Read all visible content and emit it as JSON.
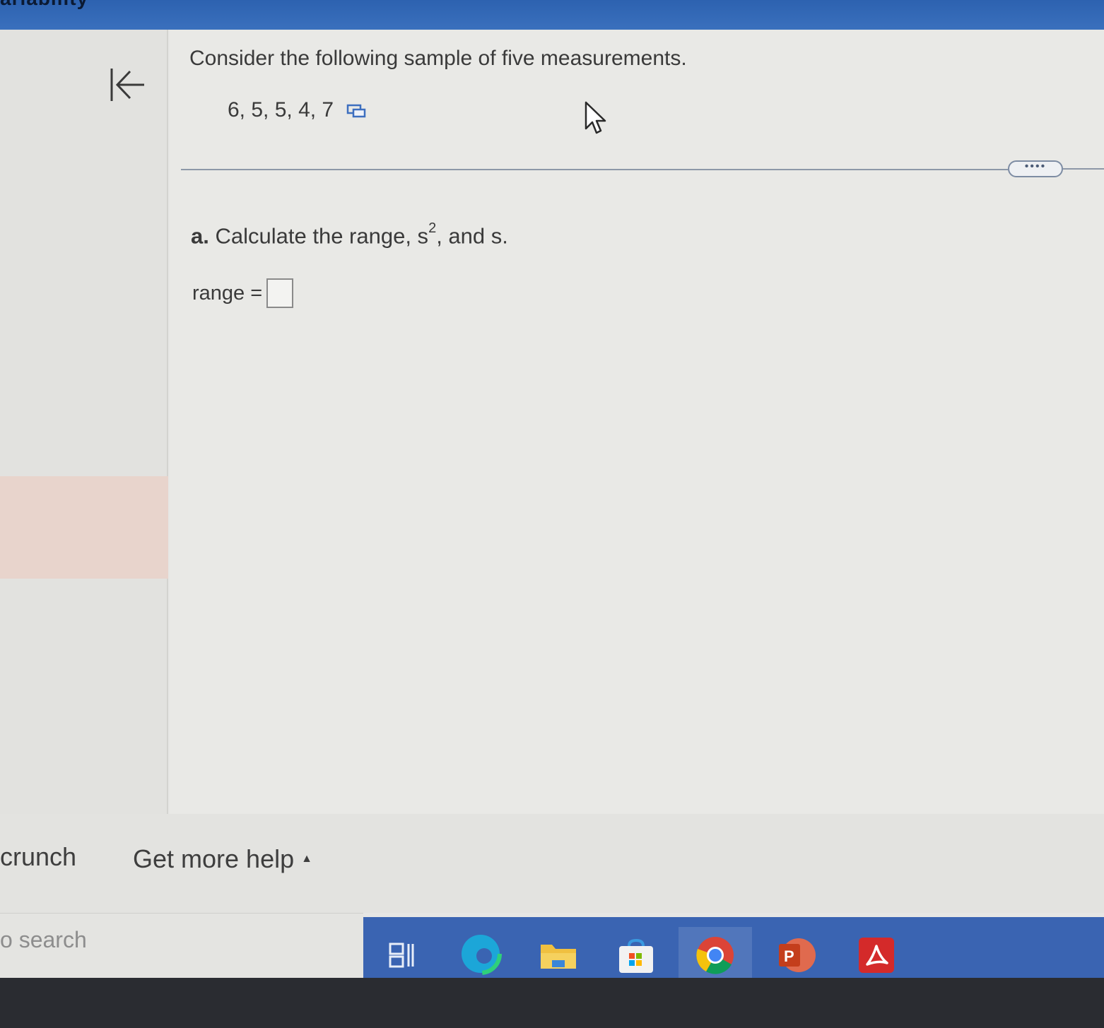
{
  "header": {
    "title": "ariability"
  },
  "sidebar": {
    "collapse_label": "collapse panel"
  },
  "problem": {
    "prompt": "Consider the following sample of five measurements.",
    "data_values": "6, 5, 5, 4, 7"
  },
  "part_a": {
    "letter": "a.",
    "text_before": "Calculate the range, s",
    "superscript": "2",
    "text_after": ", and s."
  },
  "answer": {
    "label": "range =",
    "value": ""
  },
  "more_button": {
    "label": "••••"
  },
  "footer": {
    "left_text": "crunch",
    "help_label": "Get more help"
  },
  "taskbar": {
    "search_text": "o search",
    "items": [
      "task-view",
      "edge",
      "file-explorer",
      "store",
      "chrome",
      "powerpoint",
      "acrobat"
    ]
  },
  "colors": {
    "topbar": "#3a70bd",
    "background": "#e9e9e6",
    "taskbar": "#3a64b2",
    "highlight": "#e8d4cc"
  }
}
